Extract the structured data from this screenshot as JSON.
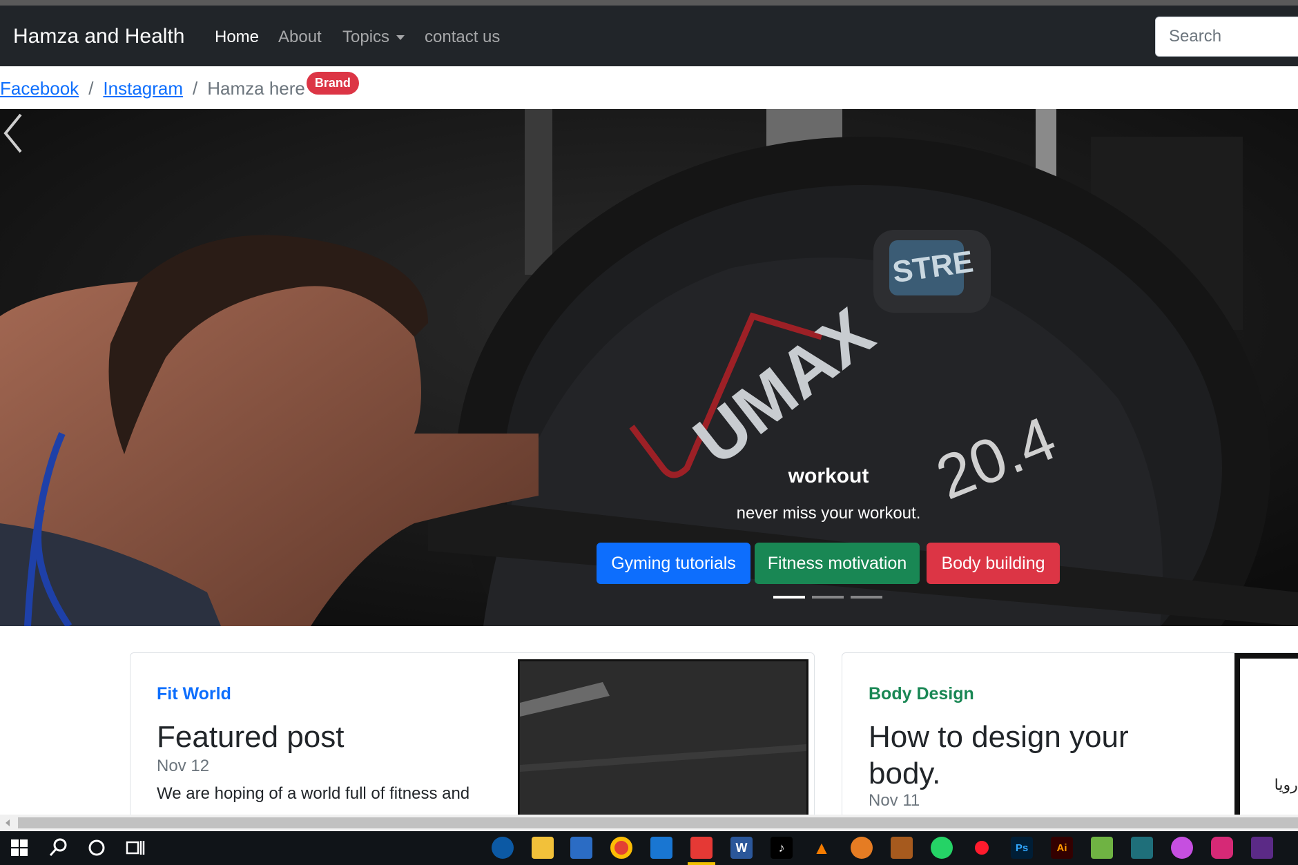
{
  "navbar": {
    "brand": "Hamza and Health",
    "links": {
      "home": "Home",
      "about": "About",
      "topics": "Topics",
      "contact": "contact us"
    },
    "search_placeholder": "Search"
  },
  "breadcrumb": {
    "facebook": "Facebook",
    "instagram": "Instagram",
    "current": "Hamza here",
    "badge": "Brand"
  },
  "carousel": {
    "caption_title": "workout",
    "caption_text": "never miss your workout.",
    "buttons": {
      "primary": "Gyming tutorials",
      "success": "Fitness motivation",
      "danger": "Body building"
    },
    "plate_logo": "UMAX",
    "plate_badge": "STRE",
    "plate_number": "20.4",
    "active_slide": 1,
    "slide_count": 3
  },
  "cards": [
    {
      "category": "Fit World",
      "title": "Featured post",
      "date": "Nov 12",
      "excerpt": "We are hoping of a world full of fitness and"
    },
    {
      "category": "Body Design",
      "title": "How to design your body.",
      "date": "Nov 11",
      "thumb_text": "بس رويا"
    }
  ],
  "taskbar": {
    "icons": [
      "windows-start-icon",
      "search-icon",
      "cortana-icon",
      "task-view-icon",
      "edge-icon",
      "file-explorer-icon",
      "store-icon",
      "chrome-icon",
      "mail-icon",
      "app-icon",
      "word-icon",
      "tiktok-icon",
      "vlc-icon",
      "paint-icon",
      "game-icon",
      "whatsapp-icon",
      "opera-icon",
      "photoshop-icon",
      "illustrator-icon",
      "app-icon",
      "app-icon",
      "itunes-icon",
      "instagram-icon",
      "app-icon"
    ],
    "word_letter": "W",
    "ps_label": "Ps",
    "ai_label": "Ai"
  },
  "colors": {
    "navbar": "#212529",
    "primary": "#0d6efd",
    "success": "#198754",
    "danger": "#dc3545"
  }
}
